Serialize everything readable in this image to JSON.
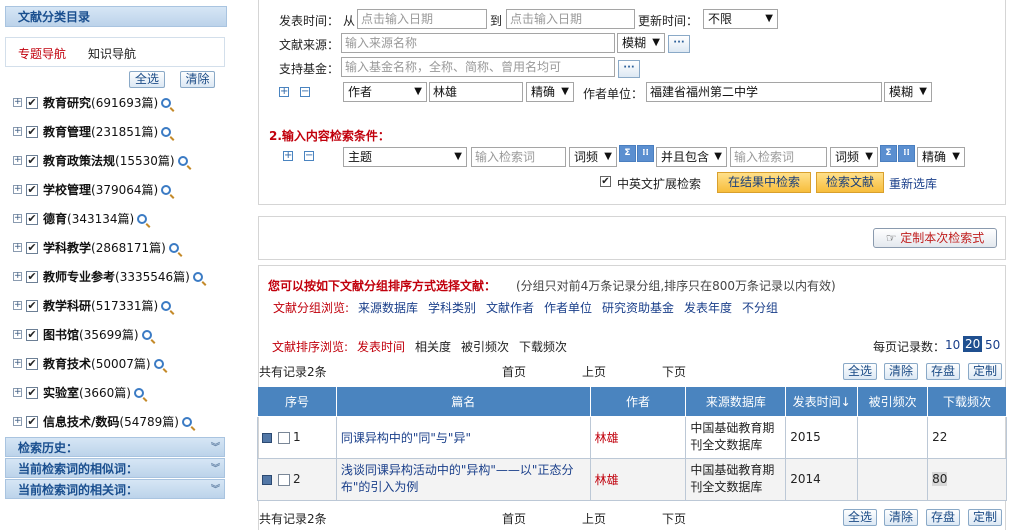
{
  "sidebar": {
    "title": "文献分类目录",
    "tab_topic": "专题导航",
    "tab_knowledge": "知识导航",
    "select_all": "全选",
    "clear": "清除",
    "categories": [
      {
        "name": "教育研究",
        "count": "(691693篇)"
      },
      {
        "name": "教育管理",
        "count": "(231851篇)"
      },
      {
        "name": "教育政策法规",
        "count": "(15530篇)"
      },
      {
        "name": "学校管理",
        "count": "(379064篇)"
      },
      {
        "name": "德育",
        "count": "(343134篇)"
      },
      {
        "name": "学科教学",
        "count": "(2868171篇)"
      },
      {
        "name": "教师专业参考",
        "count": "(3335546篇)"
      },
      {
        "name": "教学科研",
        "count": "(517331篇)"
      },
      {
        "name": "图书馆",
        "count": "(35699篇)"
      },
      {
        "name": "教育技术",
        "count": "(50007篇)"
      },
      {
        "name": "实验室",
        "count": "(3660篇)"
      },
      {
        "name": "信息技术/数码",
        "count": "(54789篇)"
      }
    ],
    "history": "检索历史：",
    "similar": "当前检索词的相似词：",
    "related": "当前检索词的相关词："
  },
  "search": {
    "pub_time_label": "发表时间：",
    "from": "从",
    "to": "到",
    "date_placeholder": "点击输入日期",
    "update_label": "更新时间：",
    "update_value": "不限",
    "source_label": "文献来源：",
    "source_placeholder": "输入来源名称",
    "fuzzy": "模糊",
    "fund_label": "支持基金：",
    "fund_placeholder": "输入基金名称，全称、简称、曾用名均可",
    "author_field": "作者",
    "author_value": "林雄",
    "exact": "精确",
    "unit_label": "作者单位：",
    "unit_value": "福建省福州第二中学",
    "unit_match": "模糊",
    "content_heading": "2.输入内容检索条件：",
    "topic_field": "主题",
    "keyword_placeholder": "输入检索词",
    "freq": "词频",
    "and_include": "并且包含",
    "freq2": "词频",
    "exact2": "精确",
    "cn_en_label": "中英文扩展检索",
    "search_in_results": "在结果中检索",
    "search_docs": "检索文献",
    "reselect": "重新选库",
    "dots": "···",
    "plus": "+",
    "minus": "−"
  },
  "custom": {
    "label": "定制本次检索式"
  },
  "results": {
    "group_intro": "您可以按如下文献分组排序方式选择文献：",
    "group_note": "(分组只对前4万条记录分组,排序只在800万条记录以内有效)",
    "group_label": "文献分组浏览:",
    "group_links": [
      "来源数据库",
      "学科类别",
      "文献作者",
      "作者单位",
      "研究资助基金",
      "发表年度",
      "不分组"
    ],
    "sort_label": "文献排序浏览:",
    "sort_links": [
      "发表时间",
      "相关度",
      "被引频次",
      "下载频次"
    ],
    "per_page_label": "每页记录数：",
    "per_page": [
      "10",
      "20",
      "50"
    ],
    "total": "共有记录2条",
    "first": "首页",
    "prev": "上页",
    "next": "下页",
    "btn_select_all": "全选",
    "btn_clear": "清除",
    "btn_save": "存盘",
    "btn_custom": "定制",
    "columns": [
      "序号",
      "篇名",
      "作者",
      "来源数据库",
      "发表时间↓",
      "被引频次",
      "下载频次"
    ],
    "rows": [
      {
        "num": "1",
        "title": "同课异构中的\"同\"与\"异\"",
        "author": "林雄",
        "db": "中国基础教育期刊全文数据库",
        "year": "2015",
        "cited": "",
        "downloads": "22"
      },
      {
        "num": "2",
        "title": "浅谈同课异构活动中的\"异构\"——以\"正态分布\"的引入为例",
        "author": "林雄",
        "db": "中国基础教育期刊全文数据库",
        "year": "2014",
        "cited": "",
        "downloads": "80"
      }
    ]
  }
}
